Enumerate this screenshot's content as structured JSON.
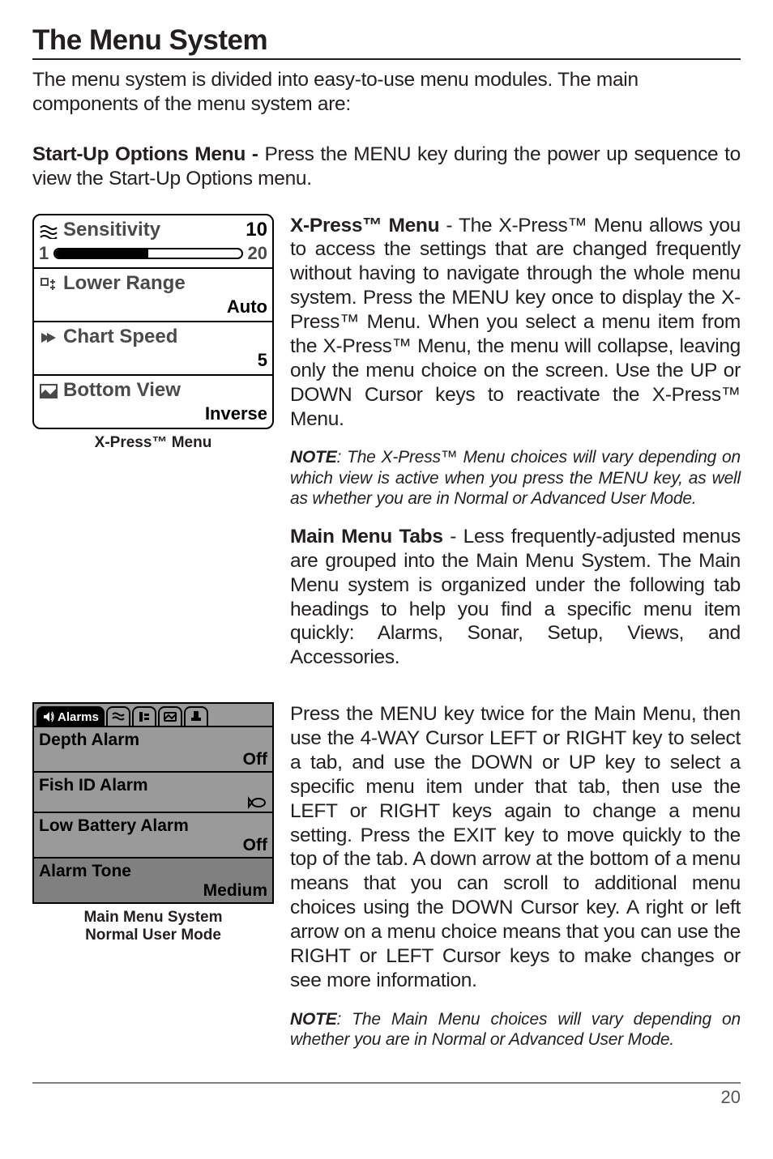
{
  "heading": "The Menu System",
  "intro": "The menu system is divided into easy-to-use menu modules. The main components of the menu system are:",
  "startup_label": "Start-Up Options Menu - ",
  "startup_text": "Press the MENU key during the power up sequence to view the Start-Up Options menu.",
  "xpress_caption": "X-Press™ Menu",
  "xpress_menu": {
    "sensitivity_label": "Sensitivity",
    "sensitivity_value": "10",
    "sensitivity_min": "1",
    "sensitivity_max": "20",
    "lower_range_label": "Lower  Range",
    "lower_range_value": "Auto",
    "chart_speed_label": "Chart  Speed",
    "chart_speed_value": "5",
    "bottom_view_label": "Bottom  View",
    "bottom_view_value": "Inverse"
  },
  "xpress_label": "X-Press™ Menu",
  "xpress_para": " - The X-Press™ Menu allows you to access the settings that are changed frequently without having to navigate through the whole menu system. Press the MENU key once to display the X-Press™ Menu.  When you select a menu item from the X-Press™ Menu, the menu will collapse, leaving only the menu choice on the screen. Use the UP or DOWN Cursor keys to reactivate the X-Press™ Menu.",
  "note1_label": "NOTE",
  "note1_text": ": The X-Press™ Menu choices will vary depending on which view is active when you press the MENU key, as well as whether you are in Normal or Advanced User Mode.",
  "mainmenu_tabs_label": "Main Menu Tabs",
  "mainmenu_tabs_para": " - Less frequently-adjusted menus are grouped into the Main Menu System. The Main Menu system is organized under the following tab headings to help you find a specific menu item quickly: Alarms, Sonar, Setup, Views, and Accessories.",
  "mainmenu_caption_line1": "Main Menu System",
  "mainmenu_caption_line2": "Normal User Mode",
  "mainmenu": {
    "active_tab_label": "Alarms",
    "depth_alarm_label": "Depth Alarm",
    "depth_alarm_value": "Off",
    "fish_id_label": "Fish ID Alarm",
    "low_battery_label": "Low Battery Alarm",
    "low_battery_value": "Off",
    "alarm_tone_label": "Alarm Tone",
    "alarm_tone_value": "Medium"
  },
  "mainmenu_para": "Press the MENU key twice for the Main Menu, then use the 4-WAY Cursor LEFT or RIGHT key to select a tab, and use the DOWN or UP key to select a specific menu item under that tab, then use the LEFT or RIGHT keys again to change a menu setting. Press the EXIT key to move quickly to the top of the tab. A down arrow at the bottom of a menu means that you can scroll to additional menu choices using the DOWN Cursor key. A right or left arrow on a menu choice means that you can use the RIGHT or LEFT Cursor keys to make changes or see more information.",
  "note2_label": "NOTE",
  "note2_text": ": The Main Menu choices will vary depending on whether you are in Normal or Advanced User Mode.",
  "page_number": "20"
}
